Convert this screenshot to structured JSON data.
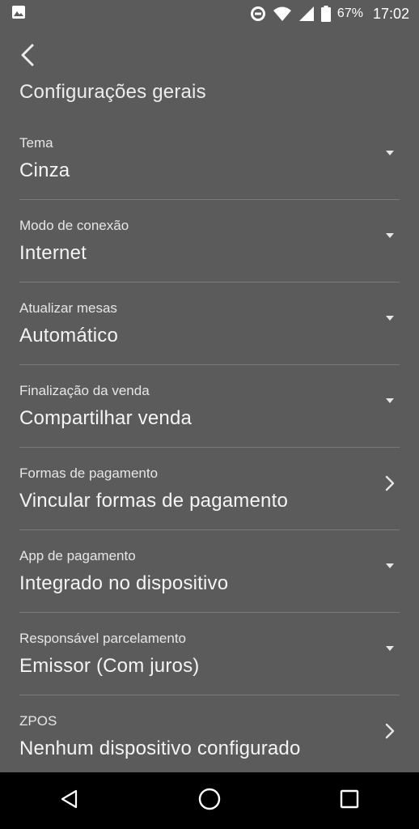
{
  "status_bar": {
    "battery_percent": "67%",
    "time": "17:02",
    "icons": [
      "image-icon",
      "do-not-disturb-icon",
      "wifi-icon",
      "signal-icon",
      "battery-icon"
    ]
  },
  "header": {
    "back_icon": "chevron-left-icon",
    "title": "Configurações gerais"
  },
  "settings": [
    {
      "label": "Tema",
      "value": "Cinza",
      "trailing_icon": "dropdown-arrow-icon"
    },
    {
      "label": "Modo de conexão",
      "value": "Internet",
      "trailing_icon": "dropdown-arrow-icon"
    },
    {
      "label": "Atualizar mesas",
      "value": "Automático",
      "trailing_icon": "dropdown-arrow-icon"
    },
    {
      "label": "Finalização da venda",
      "value": "Compartilhar venda",
      "trailing_icon": "dropdown-arrow-icon"
    },
    {
      "label": "Formas de pagamento",
      "value": "Vincular formas de pagamento",
      "trailing_icon": "chevron-right-icon"
    },
    {
      "label": "App de pagamento",
      "value": "Integrado no dispositivo",
      "trailing_icon": "dropdown-arrow-icon"
    },
    {
      "label": "Responsável parcelamento",
      "value": "Emissor (Com juros)",
      "trailing_icon": "dropdown-arrow-icon"
    },
    {
      "label": "ZPOS",
      "value": "Nenhum dispositivo configurado",
      "trailing_icon": "chevron-right-icon"
    }
  ],
  "nav_bar": {
    "icons": [
      "back-triangle-icon",
      "home-circle-icon",
      "recents-square-icon"
    ]
  },
  "colors": {
    "background": "#5b5b5b",
    "divider": "#7a7a7a",
    "nav_background": "#000000",
    "text": "#f2f2f2"
  }
}
